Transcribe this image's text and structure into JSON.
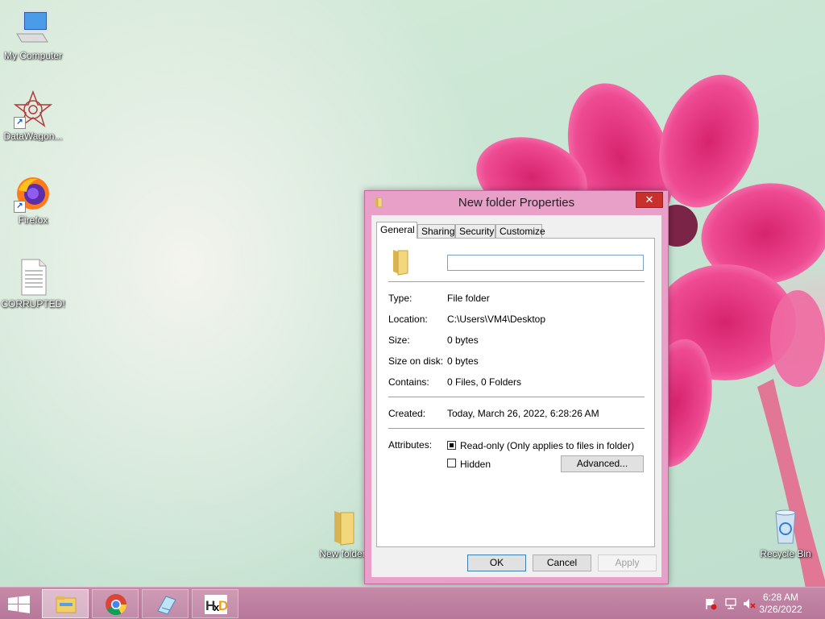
{
  "desktop": {
    "icons": [
      {
        "label": "My Computer"
      },
      {
        "label": "DataWagon..."
      },
      {
        "label": "Firefox"
      },
      {
        "label": "CORRUPTED!"
      },
      {
        "label": "New folder"
      },
      {
        "label": "Recycle Bin"
      }
    ]
  },
  "dialog": {
    "title": "New folder Properties",
    "close_label": "✕",
    "tabs": [
      {
        "label": "General"
      },
      {
        "label": "Sharing"
      },
      {
        "label": "Security"
      },
      {
        "label": "Customize"
      }
    ],
    "name_value": "",
    "properties": {
      "type_label": "Type:",
      "type_value": "File folder",
      "location_label": "Location:",
      "location_value": "C:\\Users\\VM4\\Desktop",
      "size_label": "Size:",
      "size_value": "0 bytes",
      "size_on_disk_label": "Size on disk:",
      "size_on_disk_value": "0 bytes",
      "contains_label": "Contains:",
      "contains_value": "0 Files, 0 Folders",
      "created_label": "Created:",
      "created_value": "Today, March 26, 2022, 6:28:26 AM",
      "attributes_label": "Attributes:"
    },
    "attributes": {
      "readonly_label": "Read-only (Only applies to files in folder)",
      "readonly_checked": true,
      "hidden_label": "Hidden",
      "hidden_checked": false,
      "advanced_label": "Advanced..."
    },
    "buttons": {
      "ok": "OK",
      "cancel": "Cancel",
      "apply": "Apply"
    }
  },
  "taskbar": {
    "items": [
      {
        "icon": "file-explorer-icon"
      },
      {
        "icon": "chrome-icon"
      },
      {
        "icon": "notepad-icon"
      },
      {
        "icon": "hxd-icon"
      }
    ],
    "clock_time": "6:28 AM",
    "clock_date": "3/26/2022"
  },
  "colors": {
    "titlebar": "#e8a0c8",
    "taskbar": "#b6779a",
    "close": "#c9302c"
  }
}
